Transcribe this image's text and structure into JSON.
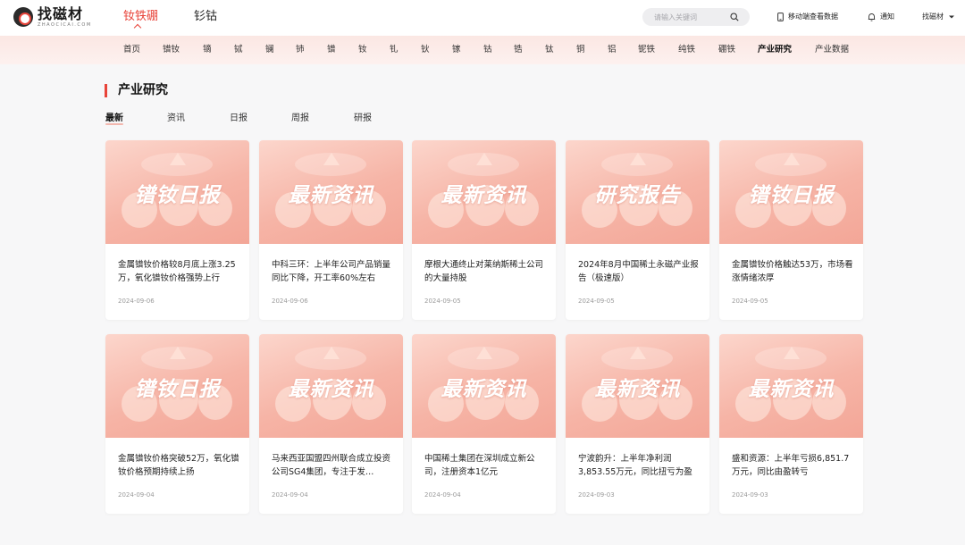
{
  "header": {
    "logo_name": "找磁材",
    "logo_sub": "ZHAOCICAI.COM",
    "main_tabs": [
      {
        "label": "钕铁硼",
        "active": true
      },
      {
        "label": "钐钴",
        "active": false
      }
    ],
    "search_placeholder": "请输入关键词",
    "mobile_label": "移动端查看数据",
    "notify_label": "通知",
    "user_label": "找磁材"
  },
  "categories": [
    "首页",
    "镨钕",
    "镝",
    "铽",
    "镧",
    "铈",
    "镨",
    "钕",
    "钆",
    "钬",
    "镓",
    "钴",
    "锆",
    "钛",
    "铜",
    "铝",
    "铌铁",
    "纯铁",
    "硼铁",
    "产业研究",
    "产业数据"
  ],
  "active_category": "产业研究",
  "section": {
    "title": "产业研究",
    "tabs": [
      "最新",
      "资讯",
      "日报",
      "周报",
      "研报"
    ],
    "active_tab": "最新"
  },
  "cards": [
    {
      "image_text": "镨钕日报",
      "title": "金属镨钕价格较8月底上涨3.25万，氧化镨钕价格强势上行",
      "date": "2024-09-06"
    },
    {
      "image_text": "最新资讯",
      "title": "中科三环：上半年公司产品销量同比下降，开工率60%左右",
      "date": "2024-09-06"
    },
    {
      "image_text": "最新资讯",
      "title": "摩根大通终止对莱纳斯稀土公司的大量持股",
      "date": "2024-09-05"
    },
    {
      "image_text": "研究报告",
      "title": "2024年8月中国稀土永磁产业报告（极速版）",
      "date": "2024-09-05"
    },
    {
      "image_text": "镨钕日报",
      "title": "金属镨钕价格触达53万，市场看涨情绪浓厚",
      "date": "2024-09-05"
    },
    {
      "image_text": "镨钕日报",
      "title": "金属镨钕价格突破52万，氧化镨钕价格预期持续上扬",
      "date": "2024-09-04"
    },
    {
      "image_text": "最新资讯",
      "title": "马来西亚国盟四州联合成立投资公司SG4集团，专注于发…",
      "date": "2024-09-04"
    },
    {
      "image_text": "最新资讯",
      "title": "中国稀土集团在深圳成立新公司，注册资本1亿元",
      "date": "2024-09-04"
    },
    {
      "image_text": "最新资讯",
      "title": "宁波韵升：上半年净利润3,853.55万元，同比扭亏为盈",
      "date": "2024-09-03"
    },
    {
      "image_text": "最新资讯",
      "title": "盛和资源：上半年亏损6,851.7万元，同比由盈转亏",
      "date": "2024-09-03"
    }
  ],
  "colors": {
    "accent": "#e8443a",
    "thumb_light": "#fcd6cc",
    "thumb_dark": "#f3a697",
    "nav_bg": "#fbe7e3"
  }
}
